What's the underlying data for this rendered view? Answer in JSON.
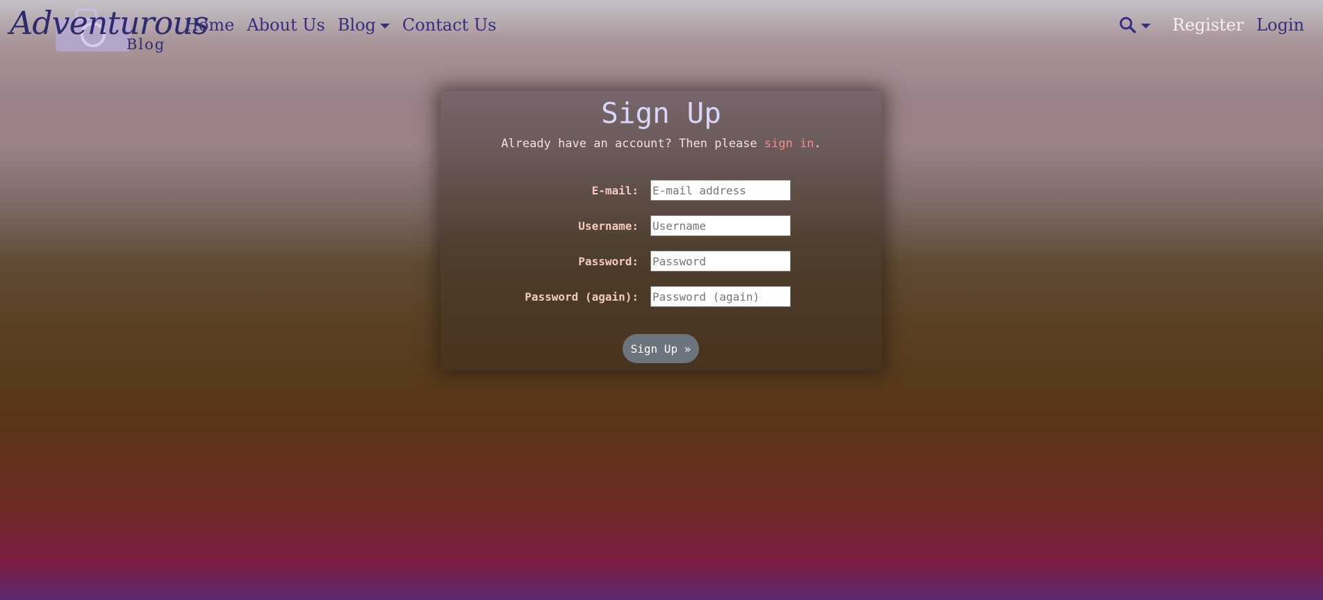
{
  "brand": {
    "script_text": "Adventurous",
    "sub_text": "Blog"
  },
  "nav": {
    "links": [
      {
        "label": "Home"
      },
      {
        "label": "About Us"
      },
      {
        "label": "Blog"
      },
      {
        "label": "Contact Us"
      }
    ],
    "right": {
      "search_icon": "search-icon",
      "register_label": "Register",
      "login_label": "Login"
    }
  },
  "signup": {
    "title": "Sign Up",
    "subtitle_prefix": "Already have an account? Then please ",
    "signin_link": "sign in",
    "subtitle_suffix": ".",
    "fields": {
      "email": {
        "label": "E-mail:",
        "placeholder": "E-mail address",
        "value": ""
      },
      "username": {
        "label": "Username:",
        "placeholder": "Username",
        "value": ""
      },
      "password": {
        "label": "Password:",
        "placeholder": "Password",
        "value": ""
      },
      "password2": {
        "label": "Password (again):",
        "placeholder": "Password (again)",
        "value": ""
      }
    },
    "submit_label": "Sign Up »"
  },
  "colors": {
    "nav_link": "#332f7e",
    "register": "#f3f0f7",
    "title": "#d9d6fb",
    "label": "#f3c9c2",
    "link_accent": "#f08f8f",
    "button": "#6c757d"
  }
}
